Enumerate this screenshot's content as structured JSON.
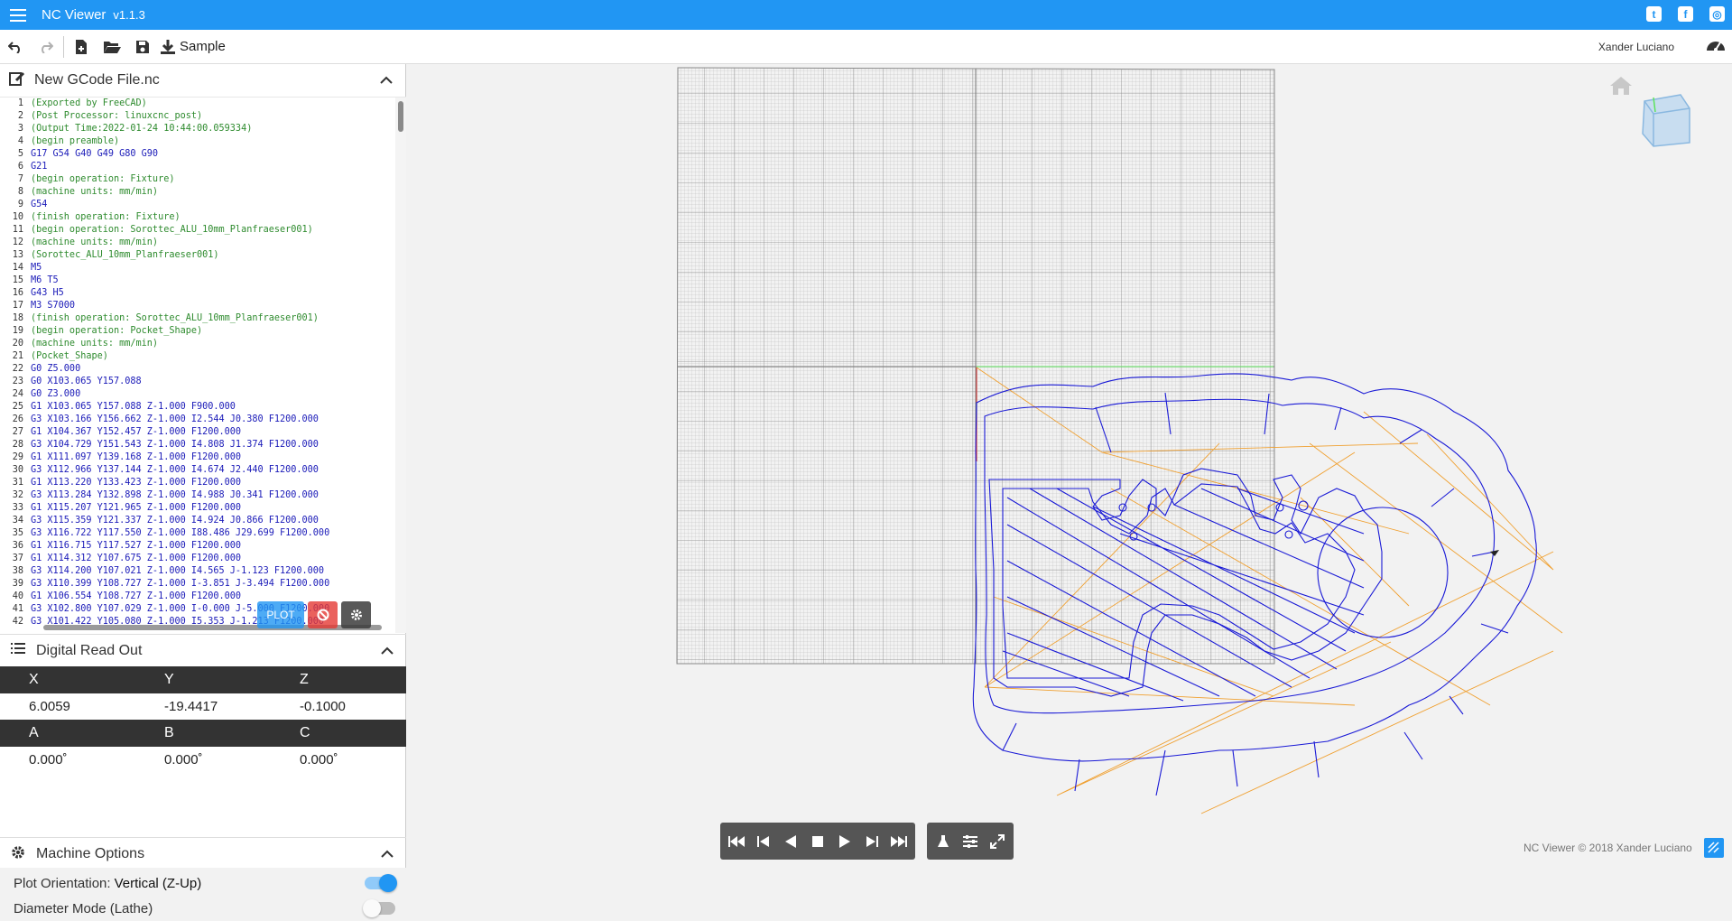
{
  "app": {
    "title": "NC Viewer",
    "version": "v1.1.3"
  },
  "toolbar": {
    "sample_label": "Sample"
  },
  "user": {
    "name": "Xander Luciano"
  },
  "editor": {
    "title": "New GCode File.nc",
    "lines": [
      {
        "n": "1",
        "t": "(Exported by FreeCAD)",
        "c": true
      },
      {
        "n": "2",
        "t": "(Post Processor: linuxcnc_post)",
        "c": true
      },
      {
        "n": "3",
        "t": "(Output Time:2022-01-24 10:44:00.059334)",
        "c": true
      },
      {
        "n": "4",
        "t": "(begin preamble)",
        "c": true
      },
      {
        "n": "5",
        "t": "G17 G54 G40 G49 G80 G90",
        "c": false
      },
      {
        "n": "6",
        "t": "G21",
        "c": false
      },
      {
        "n": "7",
        "t": "(begin operation: Fixture)",
        "c": true
      },
      {
        "n": "8",
        "t": "(machine units: mm/min)",
        "c": true
      },
      {
        "n": "9",
        "t": "G54",
        "c": false
      },
      {
        "n": "10",
        "t": "(finish operation: Fixture)",
        "c": true
      },
      {
        "n": "11",
        "t": "(begin operation: Sorottec_ALU_10mm_Planfraeser001)",
        "c": true
      },
      {
        "n": "12",
        "t": "(machine units: mm/min)",
        "c": true
      },
      {
        "n": "13",
        "t": "(Sorottec_ALU_10mm_Planfraeser001)",
        "c": true
      },
      {
        "n": "14",
        "t": "M5",
        "c": false
      },
      {
        "n": "15",
        "t": "M6 T5",
        "c": false
      },
      {
        "n": "16",
        "t": "G43 H5",
        "c": false
      },
      {
        "n": "17",
        "t": "M3 S7000",
        "c": false
      },
      {
        "n": "18",
        "t": "(finish operation: Sorottec_ALU_10mm_Planfraeser001)",
        "c": true
      },
      {
        "n": "19",
        "t": "(begin operation: Pocket_Shape)",
        "c": true
      },
      {
        "n": "20",
        "t": "(machine units: mm/min)",
        "c": true
      },
      {
        "n": "21",
        "t": "(Pocket_Shape)",
        "c": true
      },
      {
        "n": "22",
        "t": "G0 Z5.000",
        "c": false
      },
      {
        "n": "23",
        "t": "G0 X103.065 Y157.088",
        "c": false
      },
      {
        "n": "24",
        "t": "G0 Z3.000",
        "c": false
      },
      {
        "n": "25",
        "t": "G1 X103.065 Y157.088 Z-1.000 F900.000",
        "c": false
      },
      {
        "n": "26",
        "t": "G3 X103.166 Y156.662 Z-1.000 I2.544 J0.380 F1200.000",
        "c": false
      },
      {
        "n": "27",
        "t": "G1 X104.367 Y152.457 Z-1.000 F1200.000",
        "c": false
      },
      {
        "n": "28",
        "t": "G3 X104.729 Y151.543 Z-1.000 I4.808 J1.374 F1200.000",
        "c": false
      },
      {
        "n": "29",
        "t": "G1 X111.097 Y139.168 Z-1.000 F1200.000",
        "c": false
      },
      {
        "n": "30",
        "t": "G3 X112.966 Y137.144 Z-1.000 I4.674 J2.440 F1200.000",
        "c": false
      },
      {
        "n": "31",
        "t": "G1 X113.220 Y133.423 Z-1.000 F1200.000",
        "c": false
      },
      {
        "n": "32",
        "t": "G3 X113.284 Y132.898 Z-1.000 I4.988 J0.341 F1200.000",
        "c": false
      },
      {
        "n": "33",
        "t": "G1 X115.207 Y121.965 Z-1.000 F1200.000",
        "c": false
      },
      {
        "n": "34",
        "t": "G3 X115.359 Y121.337 Z-1.000 I4.924 J0.866 F1200.000",
        "c": false
      },
      {
        "n": "35",
        "t": "G3 X116.722 Y117.550 Z-1.000 I88.486 J29.699 F1200.000",
        "c": false
      },
      {
        "n": "36",
        "t": "G1 X116.715 Y117.527 Z-1.000 F1200.000",
        "c": false
      },
      {
        "n": "37",
        "t": "G1 X114.312 Y107.675 Z-1.000 F1200.000",
        "c": false
      },
      {
        "n": "38",
        "t": "G3 X114.200 Y107.021 Z-1.000 I4.565 J-1.123 F1200.000",
        "c": false
      },
      {
        "n": "39",
        "t": "G3 X110.399 Y108.727 Z-1.000 I-3.851 J-3.494 F1200.000",
        "c": false
      },
      {
        "n": "40",
        "t": "G1 X106.554 Y108.727 Z-1.000 F1200.000",
        "c": false
      },
      {
        "n": "41",
        "t": "G3 X102.800 Y107.029 Z-1.000 I-0.000 J-5.000 F1200.000",
        "c": false
      },
      {
        "n": "42",
        "t": "G3 X101.422 Y105.080 Z-1.000 I5.353 J-1.213 F1200.000",
        "c": false
      }
    ],
    "plot_label": "PLOT"
  },
  "dro": {
    "title": "Digital Read Out",
    "axes1": [
      "X",
      "Y",
      "Z"
    ],
    "vals1": [
      "6.0059",
      "-19.4417",
      "-0.1000"
    ],
    "axes2": [
      "A",
      "B",
      "C"
    ],
    "vals2": [
      "0.000˚",
      "0.000˚",
      "0.000˚"
    ]
  },
  "machine": {
    "title": "Machine Options",
    "orientation_label": "Plot Orientation:",
    "orientation_value": "Vertical (Z-Up)",
    "orientation_on": true,
    "diameter_label": "Diameter Mode (Lathe)",
    "diameter_on": false
  },
  "footer": {
    "copyright": "NC Viewer © 2018 Xander Luciano"
  },
  "colors": {
    "accent": "#2196f3",
    "toolpath": "#1a1ad6",
    "rapid": "#f0a030",
    "grid": "#9a9a9a"
  }
}
